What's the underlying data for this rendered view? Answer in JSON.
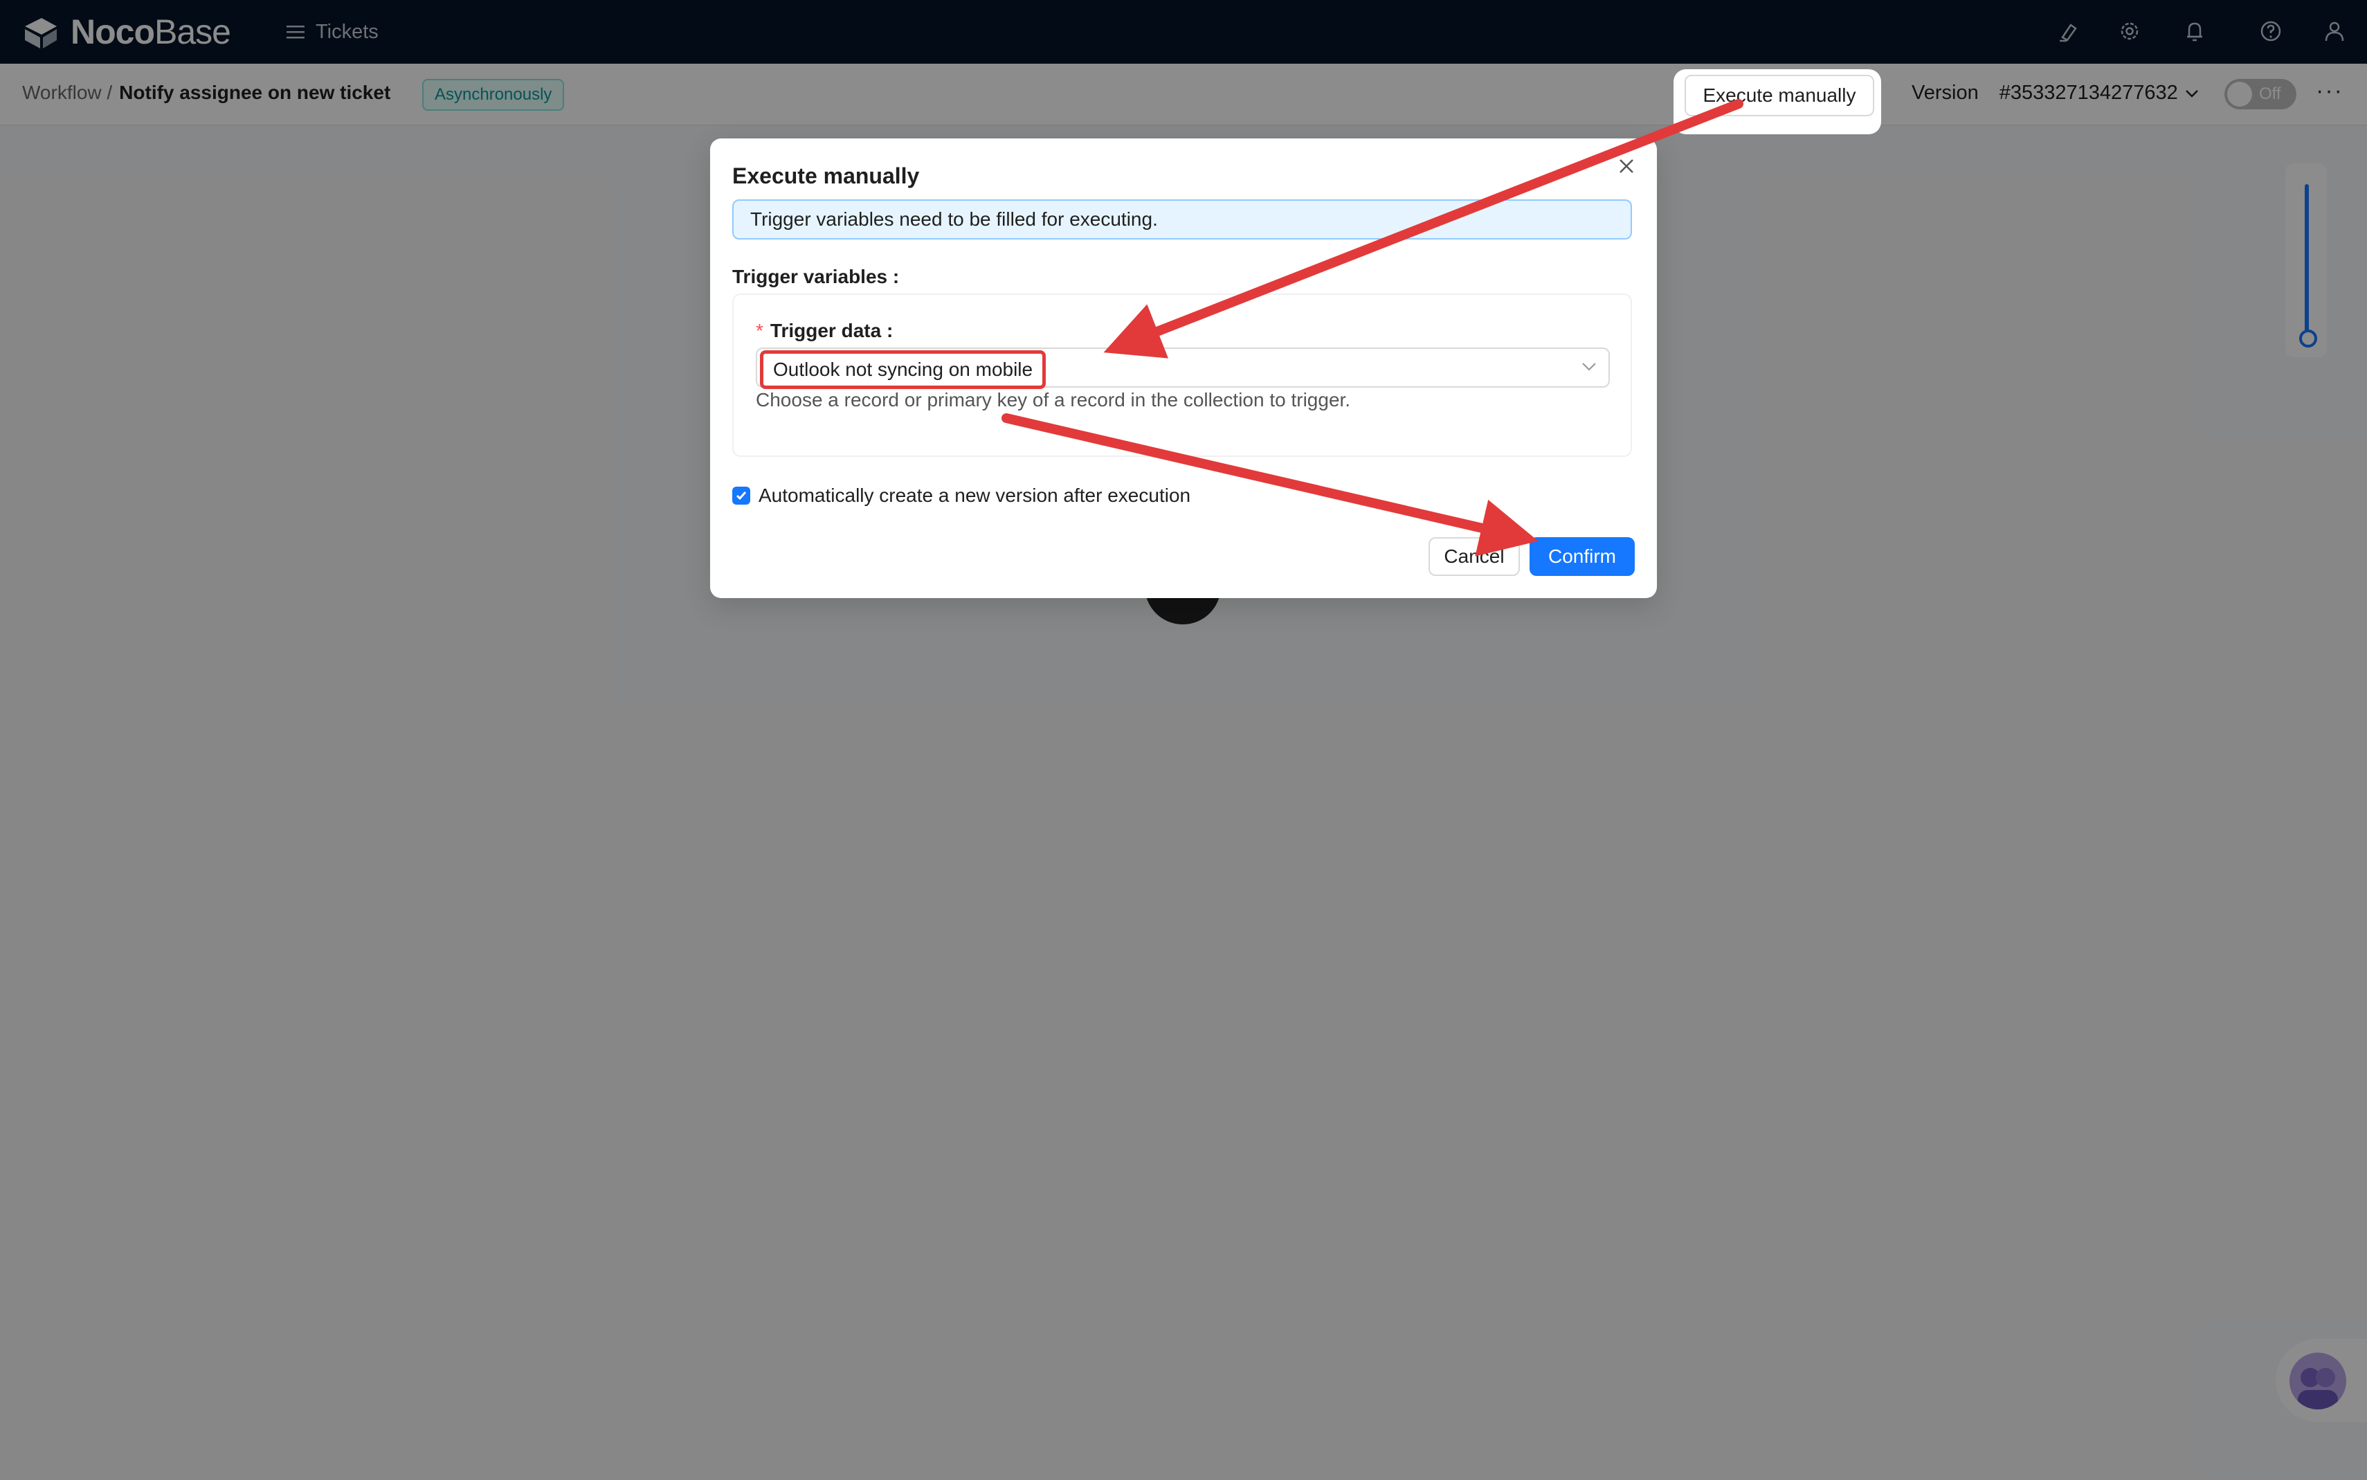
{
  "app": {
    "logo_noco": "Noco",
    "logo_base": "Base",
    "menu_label": "Tickets"
  },
  "breadcrumb": {
    "root": "Workflow /",
    "current": "Notify assignee on new ticket",
    "badge": "Asynchronously"
  },
  "header": {
    "execute_label": "Execute manually",
    "version_label": "Version",
    "version_value": "#353327134277632",
    "toggle_label": "Off",
    "more_label": "···"
  },
  "modal": {
    "title": "Execute manually",
    "alert": "Trigger variables need to be filled for executing.",
    "section_label": "Trigger variables :",
    "field_label": "Trigger data :",
    "field_value": "Outlook not syncing on mobile",
    "field_help": "Choose a record or primary key of a record in the collection to trigger.",
    "checkbox_label": "Automatically create a new version after execution",
    "checkbox_checked": true,
    "cancel_label": "Cancel",
    "confirm_label": "Confirm"
  },
  "colors": {
    "topbar": "#041529",
    "primary": "#1677ff",
    "annotation": "#e23a3a"
  },
  "icons": [
    "menu-icon",
    "highlighter-icon",
    "gear-icon",
    "bell-icon",
    "help-icon",
    "user-icon",
    "close-icon",
    "chevron-down-icon",
    "check-icon",
    "assistant-avatar-icon"
  ]
}
